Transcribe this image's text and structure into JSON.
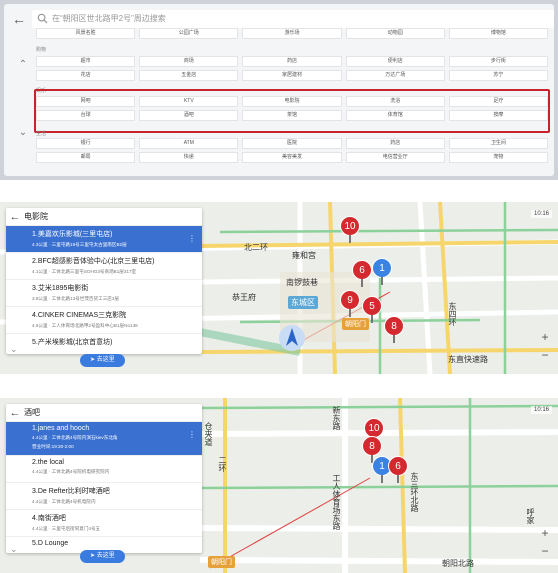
{
  "panel1": {
    "search_placeholder": "在“朝阳区世北路甲2号”周边搜索",
    "sections": [
      {
        "category": "",
        "rows": [
          [
            "风景名胜",
            "公园广场",
            "游乐场",
            "动物园",
            "博物馆"
          ]
        ]
      },
      {
        "category": "购物",
        "rows": [
          [
            "超市",
            "商场",
            "药店",
            "便利店",
            "步行街"
          ],
          [
            "花店",
            "五金店",
            "家居建材",
            "万达广场",
            "苏宁"
          ]
        ]
      },
      {
        "category": "娱乐",
        "rows": [
          [
            "网吧",
            "KTV",
            "电影院",
            "洗浴",
            "足疗"
          ],
          [
            "台球",
            "酒吧",
            "茶馆",
            "体育馆",
            "按摩"
          ]
        ]
      },
      {
        "category": "生活",
        "rows": [
          [
            "银行",
            "ATM",
            "医院",
            "药店",
            "卫生间"
          ],
          [
            "邮局",
            "快递",
            "美容美发",
            "电信营业厅",
            "宠物"
          ]
        ]
      }
    ]
  },
  "panel2": {
    "title": "电影院",
    "time": "10:16",
    "nav_button": "去这里",
    "items": [
      {
        "title": "1.美嘉欢乐影城(三里屯店)",
        "sub": "4.3公里 · 三里屯路19号三里屯太古里南区B2层"
      },
      {
        "title": "2.BFC超感影音体验中心(北京三里屯店)",
        "sub": "4.1公里 · 工体北路三里屯SOHO3号商场B1层317室"
      },
      {
        "title": "3.艾米1895电影街",
        "sub": "3.9公里 · 工体北路13号世茂百货工三店3层"
      },
      {
        "title": "4.CINKER CINEMAS三克影院",
        "sub": "4.6公里 · 工人体育场北路甲2号盈科中心B1层No138"
      },
      {
        "title": "5.产米埃影城(北京首意坊)",
        "sub": ""
      }
    ],
    "map_labels": {
      "ring": "北二环",
      "park1": "雍和宫",
      "park2": "南锣鼓巷",
      "park3": "恭王府",
      "district": "东城区",
      "rd": "朝阳门",
      "east": "东四环",
      "fast": "东直快速路"
    },
    "pins": [
      "10",
      "6",
      "1",
      "9",
      "5",
      "8"
    ]
  },
  "panel3": {
    "title": "酒吧",
    "time": "10:16",
    "nav_button": "去这里",
    "items": [
      {
        "title": "1.janes and hooch",
        "sub": "4.4公里 · 工体北路4号院内演石kiev东北角",
        "extra": "营业时间:19:30-2:00"
      },
      {
        "title": "2.the local",
        "sub": "4.4公里 · 工体北路4号院机电研究院内"
      },
      {
        "title": "3.De Refter比利时啤酒吧",
        "sub": "4.4公里 · 工体北路4号机电院内"
      },
      {
        "title": "4.南街酒吧",
        "sub": "4.4公里 · 三里屯后街同意门4号五"
      },
      {
        "title": "5.D Lounge",
        "sub": ""
      }
    ],
    "map_labels": {
      "v1": "新东路",
      "v2": "工人体育场东路",
      "v3": "东三环北路",
      "v4": "仓夹道",
      "v5": "二环",
      "road": "朝阳北路",
      "pill": "朝阳门",
      "right": "呼家"
    },
    "pins": [
      "10",
      "8",
      "1",
      "6"
    ]
  }
}
